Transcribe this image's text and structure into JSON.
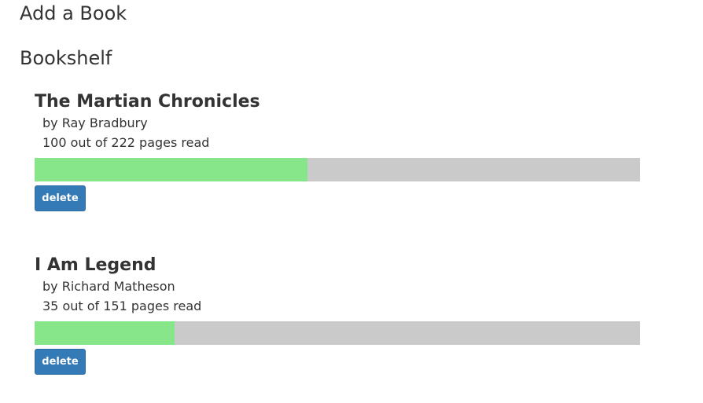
{
  "headings": {
    "add_book": "Add a Book",
    "bookshelf": "Bookshelf"
  },
  "books": [
    {
      "title": "The Martian Chronicles",
      "author_line": "by Ray Bradbury",
      "progress_line": "100 out of 222 pages read",
      "pages_read": 100,
      "pages_total": 222,
      "delete_label": "delete"
    },
    {
      "title": "I Am Legend",
      "author_line": "by Richard Matheson",
      "progress_line": "35 out of 151 pages read",
      "pages_read": 35,
      "pages_total": 151,
      "delete_label": "delete"
    }
  ],
  "colors": {
    "progress_fill": "#87e68a",
    "progress_track": "#cacaca",
    "button": "#337ab7"
  }
}
